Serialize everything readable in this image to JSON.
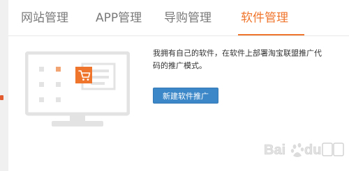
{
  "tabs": [
    {
      "label": "网站管理",
      "active": false
    },
    {
      "label": "APP管理",
      "active": false
    },
    {
      "label": "导购管理",
      "active": false
    },
    {
      "label": "软件管理",
      "active": true
    }
  ],
  "content": {
    "description": "我拥有自己的软件，在软件上部署淘宝联盟推广代码的推广模式。",
    "new_button_label": "新建软件推广"
  },
  "illustration": {
    "icon": "computer-with-cart-icon"
  },
  "watermark": {
    "brand": "Baidu经验",
    "icon": "baidu-paw-logo"
  },
  "colors": {
    "accent": "#f0752c",
    "button": "#3b87c8",
    "tab_text": "#7a7a7a",
    "illustration_gray": "#e3e3e3"
  }
}
